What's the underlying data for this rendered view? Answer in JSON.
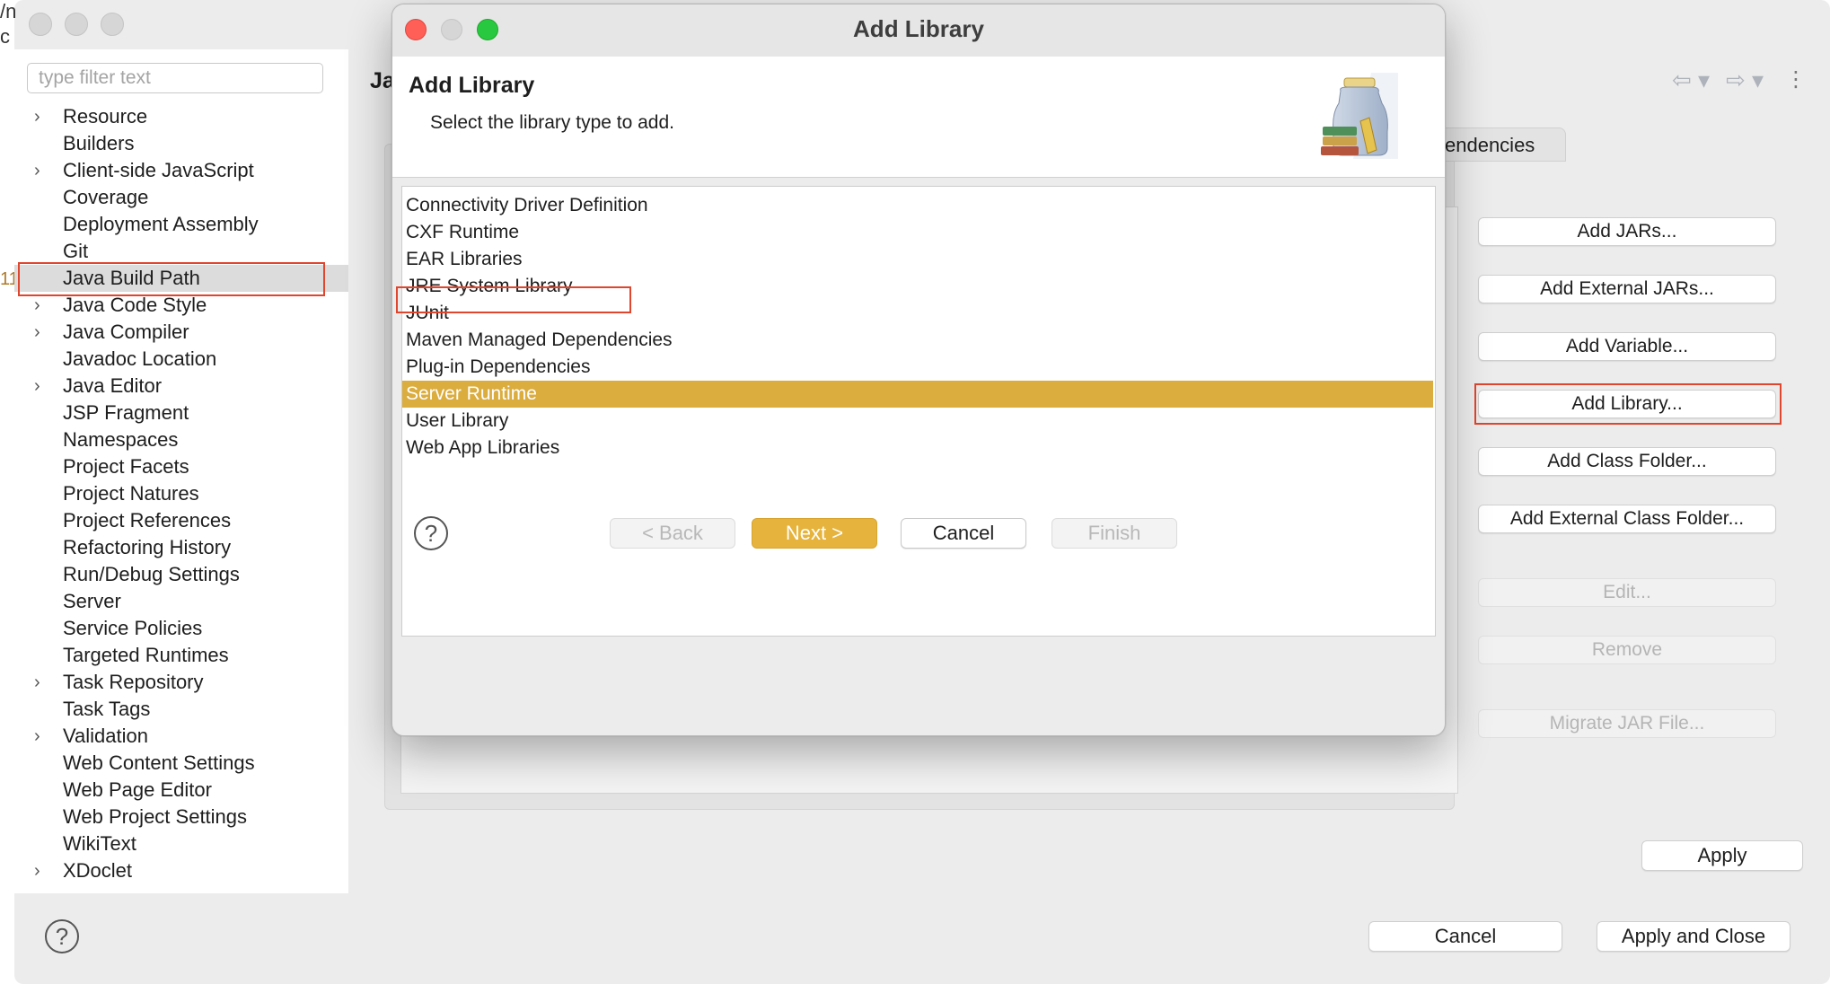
{
  "window": {
    "stray_top": "/n",
    "stray_mid": "c",
    "stray_num": "11"
  },
  "sidebar": {
    "filter_placeholder": "type filter text",
    "items": [
      {
        "label": "Resource",
        "expandable": true
      },
      {
        "label": "Builders",
        "expandable": false
      },
      {
        "label": "Client-side JavaScript",
        "expandable": true
      },
      {
        "label": "Coverage",
        "expandable": false
      },
      {
        "label": "Deployment Assembly",
        "expandable": false
      },
      {
        "label": "Git",
        "expandable": false
      },
      {
        "label": "Java Build Path",
        "expandable": false,
        "selected": true
      },
      {
        "label": "Java Code Style",
        "expandable": true
      },
      {
        "label": "Java Compiler",
        "expandable": true
      },
      {
        "label": "Javadoc Location",
        "expandable": false
      },
      {
        "label": "Java Editor",
        "expandable": true
      },
      {
        "label": "JSP Fragment",
        "expandable": false
      },
      {
        "label": "Namespaces",
        "expandable": false
      },
      {
        "label": "Project Facets",
        "expandable": false
      },
      {
        "label": "Project Natures",
        "expandable": false
      },
      {
        "label": "Project References",
        "expandable": false
      },
      {
        "label": "Refactoring History",
        "expandable": false
      },
      {
        "label": "Run/Debug Settings",
        "expandable": false
      },
      {
        "label": "Server",
        "expandable": false
      },
      {
        "label": "Service Policies",
        "expandable": false
      },
      {
        "label": "Targeted Runtimes",
        "expandable": false
      },
      {
        "label": "Task Repository",
        "expandable": true
      },
      {
        "label": "Task Tags",
        "expandable": false
      },
      {
        "label": "Validation",
        "expandable": true
      },
      {
        "label": "Web Content Settings",
        "expandable": false
      },
      {
        "label": "Web Page Editor",
        "expandable": false
      },
      {
        "label": "Web Project Settings",
        "expandable": false
      },
      {
        "label": "WikiText",
        "expandable": false
      },
      {
        "label": "XDoclet",
        "expandable": true
      }
    ]
  },
  "main": {
    "page_title_partial": "Ja",
    "tab_partial": "endencies",
    "buttons": [
      {
        "label": "Add JARs...",
        "enabled": true
      },
      {
        "label": "Add External JARs...",
        "enabled": true
      },
      {
        "label": "Add Variable...",
        "enabled": true
      },
      {
        "label": "Add Library...",
        "enabled": true,
        "highlighted": true
      },
      {
        "label": "Add Class Folder...",
        "enabled": true
      },
      {
        "label": "Add External Class Folder...",
        "enabled": true
      },
      {
        "label": "Edit...",
        "enabled": false
      },
      {
        "label": "Remove",
        "enabled": false
      },
      {
        "label": "Migrate JAR File...",
        "enabled": false
      }
    ],
    "apply_label": "Apply",
    "cancel_label": "Cancel",
    "apply_close_label": "Apply and Close",
    "help_glyph": "?",
    "nav_back_glyph": "⇦ ▾",
    "nav_fwd_glyph": "⇨ ▾",
    "menu_glyph": "⋮"
  },
  "dialog": {
    "window_title": "Add Library",
    "header_title": "Add Library",
    "header_subtitle": "Select the library type to add.",
    "library_types": [
      {
        "label": "Connectivity Driver Definition"
      },
      {
        "label": "CXF Runtime"
      },
      {
        "label": "EAR Libraries"
      },
      {
        "label": "JRE System Library"
      },
      {
        "label": "JUnit"
      },
      {
        "label": "Maven Managed Dependencies"
      },
      {
        "label": "Plug-in Dependencies"
      },
      {
        "label": "Server Runtime",
        "selected": true
      },
      {
        "label": "User Library"
      },
      {
        "label": "Web App Libraries"
      }
    ],
    "help_glyph": "?",
    "back_label": "< Back",
    "next_label": "Next >",
    "cancel_label": "Cancel",
    "finish_label": "Finish"
  },
  "colors": {
    "selection": "#dbac3e",
    "primary_button": "#e6b33c",
    "highlight_box": "#e0452d"
  }
}
